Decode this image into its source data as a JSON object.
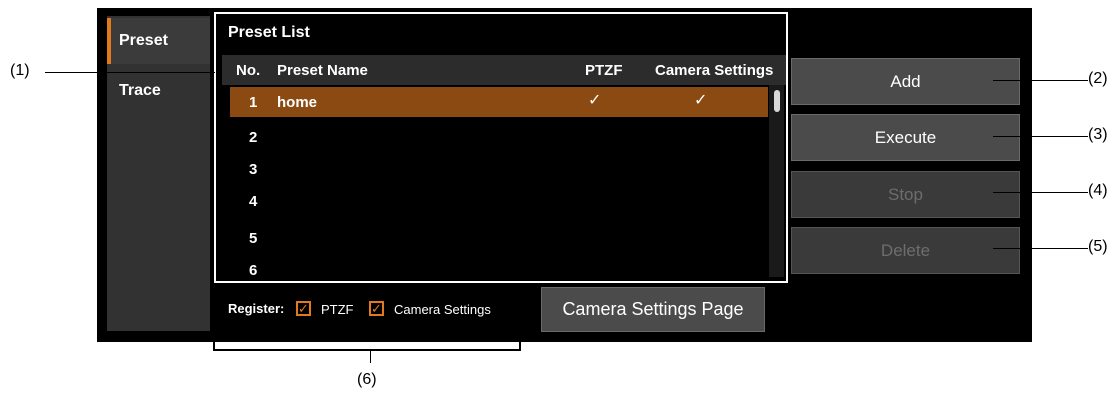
{
  "tabs": [
    {
      "label": "Preset"
    },
    {
      "label": "Trace"
    }
  ],
  "preset_list": {
    "title": "Preset List",
    "columns": {
      "no": "No.",
      "name": "Preset Name",
      "ptzf": "PTZF",
      "camera": "Camera Settings"
    },
    "rows": [
      {
        "no": "1",
        "name": "home",
        "ptzf": "✓",
        "camera": "✓",
        "selected": true
      },
      {
        "no": "2",
        "name": "",
        "ptzf": "",
        "camera": ""
      },
      {
        "no": "3",
        "name": "",
        "ptzf": "",
        "camera": ""
      },
      {
        "no": "4",
        "name": "",
        "ptzf": "",
        "camera": ""
      },
      {
        "no": "5",
        "name": "",
        "ptzf": "",
        "camera": ""
      },
      {
        "no": "6",
        "name": "",
        "ptzf": "",
        "camera": ""
      }
    ]
  },
  "buttons": {
    "add": "Add",
    "execute": "Execute",
    "stop": "Stop",
    "delete": "Delete",
    "camera_settings_page": "Camera Settings Page"
  },
  "register": {
    "label": "Register:",
    "ptzf_label": "PTZF",
    "camera_label": "Camera Settings",
    "ptzf_checked": true,
    "camera_checked": true,
    "check_glyph": "✓"
  },
  "callouts": {
    "c1": "(1)",
    "c2": "(2)",
    "c3": "(3)",
    "c4": "(4)",
    "c5": "(5)",
    "c6": "(6)"
  },
  "colors": {
    "accent": "#e07a1d",
    "selected_row": "#8a4a12",
    "panel_bg": "#000000"
  }
}
